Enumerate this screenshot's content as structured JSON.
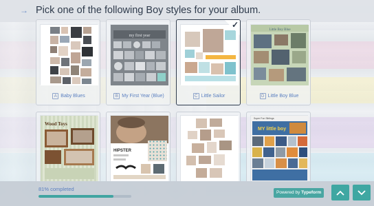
{
  "header": {
    "arrow_icon": "arrow-right-icon",
    "question": "Pick one of the following Boy styles for your album."
  },
  "choices": [
    {
      "key": "A",
      "label": "Baby Blues",
      "selected": false
    },
    {
      "key": "B",
      "label": "My First Year (Blue)",
      "selected": false
    },
    {
      "key": "C",
      "label": "Little Sailor",
      "selected": true
    },
    {
      "key": "D",
      "label": "Little Boy Blue",
      "selected": false
    },
    {
      "key": "E",
      "label": "",
      "selected": false
    },
    {
      "key": "F",
      "label": "",
      "selected": false
    },
    {
      "key": "G",
      "label": "",
      "selected": false
    },
    {
      "key": "H",
      "label": "",
      "selected": false
    }
  ],
  "thumb_text": {
    "b_banner": "my first year",
    "d_title": "Little Boy Blue",
    "e_title": "Wood Toys",
    "f_title": "HIPSTER",
    "h_banner": "Super Fun Siblings",
    "h_title": "MY little boy"
  },
  "footer": {
    "progress_text": "81% completed",
    "progress_fraction": 0.81,
    "powered_prefix": "Powered by ",
    "powered_brand": "Typeform",
    "up_icon": "chevron-up-icon",
    "down_icon": "chevron-down-icon"
  },
  "colors": {
    "accent": "#41a5a1",
    "label_blue": "#5a7fc0",
    "title": "#2f3b4c"
  }
}
